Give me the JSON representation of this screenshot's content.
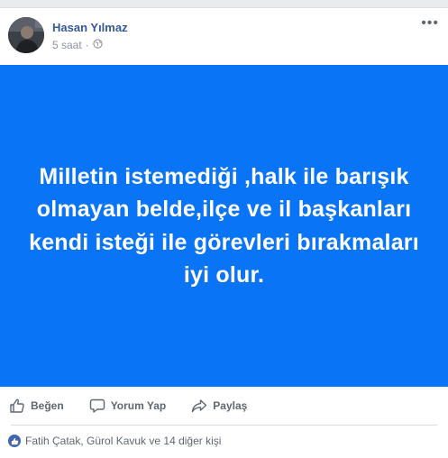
{
  "post": {
    "author": "Hasan Yılmaz",
    "time": "5 saat",
    "separator": "·",
    "audience_icon": "globe-icon",
    "more_icon": "ellipsis-icon",
    "text": "Milletin istemediği ,halk ile barışık olmayan belde,ilçe ve il başkanları kendi isteği ile görevleri bırakmaları iyi olur.",
    "background_color": "#0a74f6"
  },
  "actions": {
    "like_label": "Beğen",
    "comment_label": "Yorum Yap",
    "share_label": "Paylaş"
  },
  "reactions": {
    "summary": "Fatih Çatak, Gürol Kavuk ve 14 diğer kişi",
    "icon": "like-icon"
  },
  "colors": {
    "author_link": "#365899",
    "like_badge": "#4267b2"
  }
}
